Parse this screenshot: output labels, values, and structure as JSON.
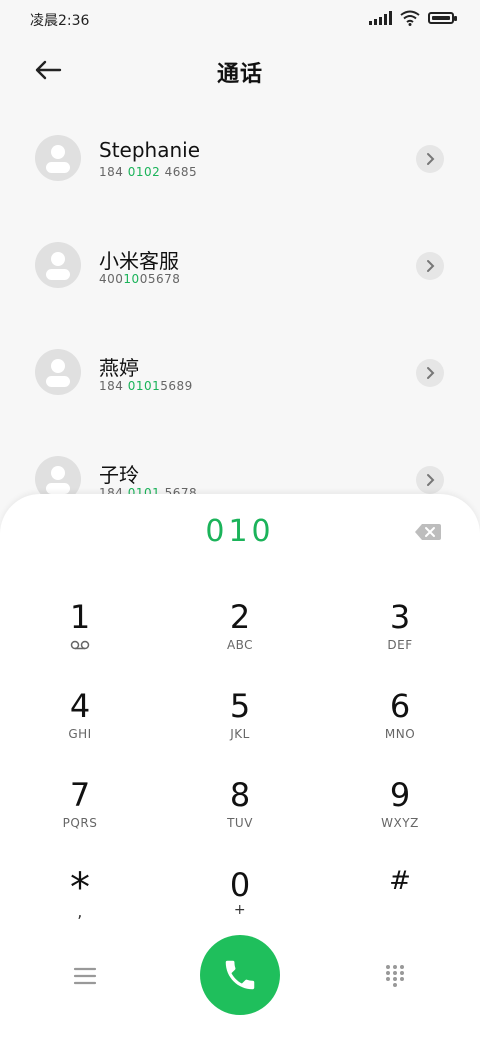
{
  "status_bar": {
    "time": "凌晨2:36"
  },
  "header": {
    "title": "通话"
  },
  "contacts": [
    {
      "name": "Stephanie",
      "num_pre": "184 ",
      "num_hl": "0102",
      "num_post": " 4685"
    },
    {
      "name": "小米客服",
      "num_pre": "400",
      "num_hl": "10",
      "num_post": "05678"
    },
    {
      "name": "燕婷",
      "num_pre": "184 ",
      "num_hl": "0101",
      "num_post": "5689"
    },
    {
      "name": "子玲",
      "num_pre": "184 ",
      "num_hl": "0101",
      "num_post": " 5678"
    }
  ],
  "dialer": {
    "input": "010",
    "keys": [
      {
        "digit": "1",
        "letters": ""
      },
      {
        "digit": "2",
        "letters": "ABC"
      },
      {
        "digit": "3",
        "letters": "DEF"
      },
      {
        "digit": "4",
        "letters": "GHI"
      },
      {
        "digit": "5",
        "letters": "JKL"
      },
      {
        "digit": "6",
        "letters": "MNO"
      },
      {
        "digit": "7",
        "letters": "PQRS"
      },
      {
        "digit": "8",
        "letters": "TUV"
      },
      {
        "digit": "9",
        "letters": "WXYZ"
      },
      {
        "digit": "*",
        "letters": ","
      },
      {
        "digit": "0",
        "letters": "+"
      },
      {
        "digit": "#",
        "letters": ""
      }
    ]
  },
  "colors": {
    "accent": "#1bb35a",
    "call_button": "#1fbf5c"
  },
  "icons": [
    "back-arrow-icon",
    "chevron-right-icon",
    "voicemail-icon",
    "backspace-icon",
    "menu-icon",
    "phone-icon",
    "dialpad-icon",
    "signal-icon",
    "wifi-icon",
    "battery-icon"
  ]
}
